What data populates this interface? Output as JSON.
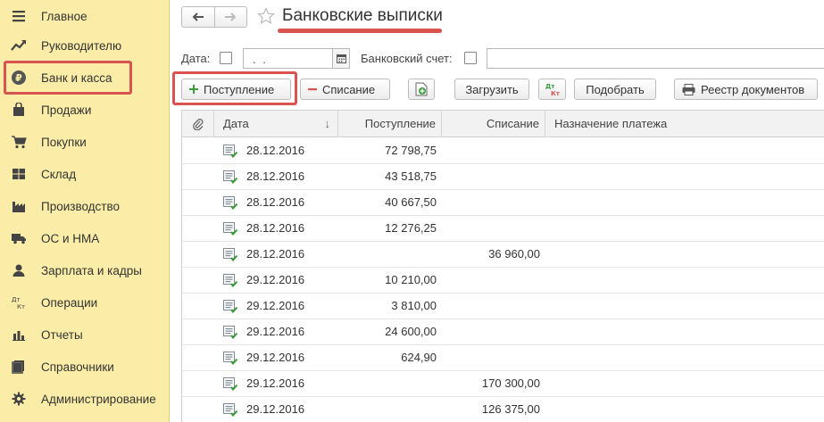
{
  "sidebar": {
    "items": [
      {
        "label": "Главное",
        "icon": "menu-icon"
      },
      {
        "label": "Руководителю",
        "icon": "trend-icon"
      },
      {
        "label": "Банк и касса",
        "icon": "ruble-coin-icon"
      },
      {
        "label": "Продажи",
        "icon": "shopping-bag-icon"
      },
      {
        "label": "Покупки",
        "icon": "cart-icon"
      },
      {
        "label": "Склад",
        "icon": "warehouse-icon"
      },
      {
        "label": "Производство",
        "icon": "factory-icon"
      },
      {
        "label": "ОС и НМА",
        "icon": "truck-icon"
      },
      {
        "label": "Зарплата и кадры",
        "icon": "person-icon"
      },
      {
        "label": "Операции",
        "icon": "dt-kt-icon"
      },
      {
        "label": "Отчеты",
        "icon": "bar-chart-icon"
      },
      {
        "label": "Справочники",
        "icon": "books-icon"
      },
      {
        "label": "Администрирование",
        "icon": "gear-icon"
      }
    ]
  },
  "header": {
    "title": "Банковские выписки"
  },
  "filters": {
    "date_label": "Дата:",
    "date_value": ". .",
    "account_label": "Банковский счет:"
  },
  "toolbar": {
    "income_label": "Поступление",
    "expense_label": "Списание",
    "load_label": "Загрузить",
    "pick_label": "Подобрать",
    "registry_label": "Реестр документов"
  },
  "table": {
    "columns": {
      "date": "Дата",
      "sort_indicator": "↓",
      "income": "Поступление",
      "expense": "Списание",
      "purpose": "Назначение платежа"
    },
    "rows": [
      {
        "date": "28.12.2016",
        "income": "72 798,75",
        "expense": ""
      },
      {
        "date": "28.12.2016",
        "income": "43 518,75",
        "expense": ""
      },
      {
        "date": "28.12.2016",
        "income": "40 667,50",
        "expense": ""
      },
      {
        "date": "28.12.2016",
        "income": "12 276,25",
        "expense": ""
      },
      {
        "date": "28.12.2016",
        "income": "",
        "expense": "36 960,00"
      },
      {
        "date": "29.12.2016",
        "income": "10 210,00",
        "expense": ""
      },
      {
        "date": "29.12.2016",
        "income": "3 810,00",
        "expense": ""
      },
      {
        "date": "29.12.2016",
        "income": "24 600,00",
        "expense": ""
      },
      {
        "date": "29.12.2016",
        "income": "624,90",
        "expense": ""
      },
      {
        "date": "29.12.2016",
        "income": "",
        "expense": "170 300,00"
      },
      {
        "date": "29.12.2016",
        "income": "",
        "expense": "126 375,00"
      }
    ]
  },
  "colors": {
    "sidebar_bg": "#fbeda7",
    "highlight": "#d9534f",
    "plus_green": "#3c9b3c",
    "minus_red": "#d9534f"
  }
}
